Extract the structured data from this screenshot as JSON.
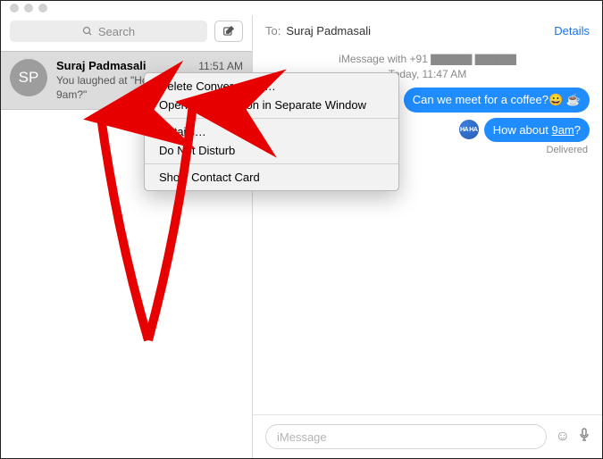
{
  "search": {
    "placeholder": "Search"
  },
  "conversation": {
    "name": "Suraj Padmasali",
    "initials": "SP",
    "time": "11:51 AM",
    "preview_l1": "You laughed at \"How about",
    "preview_l2": "9am?\""
  },
  "header": {
    "to_label": "To:",
    "to_name": "Suraj Padmasali",
    "details": "Details"
  },
  "thread": {
    "meta_line1": "iMessage with +91 ▇▇▇▇▇ ▇▇▇▇▇",
    "meta_line2": "Today, 11:47 AM",
    "msg1": "Can we meet for a coffee?😀 ☕",
    "sticker_text": "HA HA",
    "msg2_pre": "How about ",
    "msg2_link": "9am",
    "msg2_post": "?",
    "delivered": "Delivered"
  },
  "input": {
    "placeholder": "iMessage"
  },
  "context_menu": {
    "item1": "Delete Conversation…",
    "item2": "Open Conversation in Separate Window",
    "item3": "Details…",
    "item4": "Do Not Disturb",
    "item5": "Show Contact Card"
  }
}
